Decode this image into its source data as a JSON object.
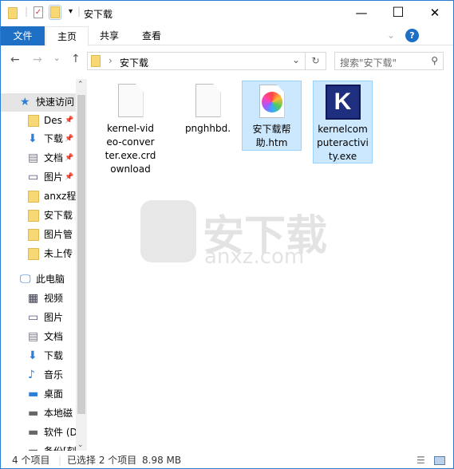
{
  "window": {
    "title": "安下载",
    "minimize": "—",
    "maximize": "☐",
    "close": "✕"
  },
  "ribbon": {
    "tabs": [
      "文件",
      "主页",
      "共享",
      "查看"
    ],
    "file_tab_color": "#1e6fc6"
  },
  "nav": {
    "breadcrumb": [
      "安下载"
    ],
    "search_placeholder": "搜索\"安下载\""
  },
  "sidebar": {
    "items": [
      {
        "label": "快速访问",
        "icon": "star-icon"
      },
      {
        "label": "Des",
        "icon": "folder-icon",
        "pinned": true
      },
      {
        "label": "下载",
        "icon": "download-icon",
        "pinned": true
      },
      {
        "label": "文档",
        "icon": "document-icon",
        "pinned": true
      },
      {
        "label": "图片",
        "icon": "picture-icon",
        "pinned": true
      },
      {
        "label": "anxz程",
        "icon": "folder-icon"
      },
      {
        "label": "安下载",
        "icon": "folder-icon"
      },
      {
        "label": "图片管",
        "icon": "folder-icon"
      },
      {
        "label": "未上传",
        "icon": "folder-icon"
      },
      {
        "label": "此电脑",
        "icon": "computer-icon"
      },
      {
        "label": "视频",
        "icon": "video-icon"
      },
      {
        "label": "图片",
        "icon": "picture-icon"
      },
      {
        "label": "文档",
        "icon": "document-icon"
      },
      {
        "label": "下载",
        "icon": "download-icon"
      },
      {
        "label": "音乐",
        "icon": "music-icon"
      },
      {
        "label": "桌面",
        "icon": "desktop-icon"
      },
      {
        "label": "本地磁",
        "icon": "drive-icon"
      },
      {
        "label": "软件 (D",
        "icon": "drive-icon"
      },
      {
        "label": "备份[刻",
        "icon": "drive-icon"
      }
    ]
  },
  "files": [
    {
      "name": "kernel-video-converter.exe.crdownload",
      "lines": [
        "kernel-vid",
        "eo-conver",
        "ter.exe.crd",
        "ownload"
      ],
      "selected": false,
      "icon": "blank-file-icon"
    },
    {
      "name": "pnghhbd.",
      "lines": [
        "pnghhbd."
      ],
      "selected": false,
      "icon": "blank-file-icon"
    },
    {
      "name": "安下载帮助.htm",
      "lines": [
        "安下载帮",
        "助.htm"
      ],
      "selected": true,
      "icon": "browser-file-icon"
    },
    {
      "name": "kernelcomputeractivity.exe",
      "lines": [
        "kernelcom",
        "puteractivi",
        "ty.exe"
      ],
      "selected": true,
      "icon": "kernel-app-icon"
    }
  ],
  "watermark": {
    "text": "安下载",
    "sub": "anxz.com"
  },
  "status": {
    "count": "4 个项目",
    "selection": "已选择 2 个项目",
    "size": "8.98 MB"
  }
}
